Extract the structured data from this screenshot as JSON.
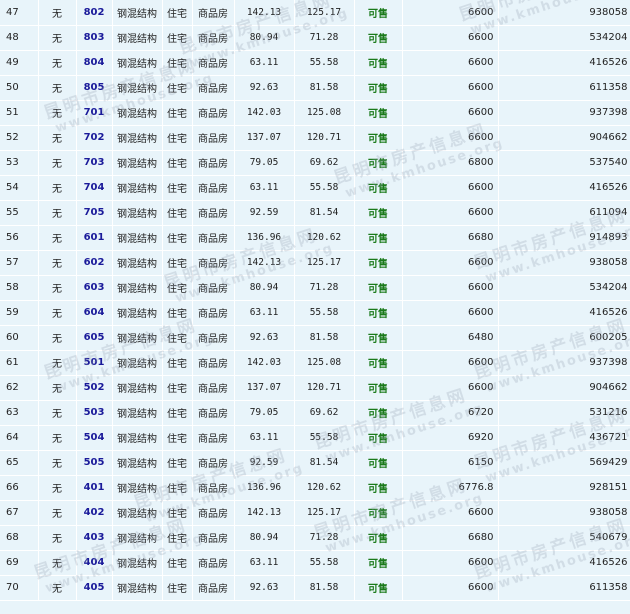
{
  "table": {
    "rows": [
      {
        "no": "47",
        "col2": "无",
        "room": "802",
        "structure": "钢混结构",
        "use": "住宅",
        "type": "商品房",
        "area1": "142.13",
        "area2": "125.17",
        "status": "可售",
        "price": "6600",
        "total": "938058"
      },
      {
        "no": "48",
        "col2": "无",
        "room": "803",
        "structure": "钢混结构",
        "use": "住宅",
        "type": "商品房",
        "area1": "80.94",
        "area2": "71.28",
        "status": "可售",
        "price": "6600",
        "total": "534204"
      },
      {
        "no": "49",
        "col2": "无",
        "room": "804",
        "structure": "钢混结构",
        "use": "住宅",
        "type": "商品房",
        "area1": "63.11",
        "area2": "55.58",
        "status": "可售",
        "price": "6600",
        "total": "416526"
      },
      {
        "no": "50",
        "col2": "无",
        "room": "805",
        "structure": "钢混结构",
        "use": "住宅",
        "type": "商品房",
        "area1": "92.63",
        "area2": "81.58",
        "status": "可售",
        "price": "6600",
        "total": "611358"
      },
      {
        "no": "51",
        "col2": "无",
        "room": "701",
        "structure": "钢混结构",
        "use": "住宅",
        "type": "商品房",
        "area1": "142.03",
        "area2": "125.08",
        "status": "可售",
        "price": "6600",
        "total": "937398"
      },
      {
        "no": "52",
        "col2": "无",
        "room": "702",
        "structure": "钢混结构",
        "use": "住宅",
        "type": "商品房",
        "area1": "137.07",
        "area2": "120.71",
        "status": "可售",
        "price": "6600",
        "total": "904662"
      },
      {
        "no": "53",
        "col2": "无",
        "room": "703",
        "structure": "钢混结构",
        "use": "住宅",
        "type": "商品房",
        "area1": "79.05",
        "area2": "69.62",
        "status": "可售",
        "price": "6800",
        "total": "537540"
      },
      {
        "no": "54",
        "col2": "无",
        "room": "704",
        "structure": "钢混结构",
        "use": "住宅",
        "type": "商品房",
        "area1": "63.11",
        "area2": "55.58",
        "status": "可售",
        "price": "6600",
        "total": "416526"
      },
      {
        "no": "55",
        "col2": "无",
        "room": "705",
        "structure": "钢混结构",
        "use": "住宅",
        "type": "商品房",
        "area1": "92.59",
        "area2": "81.54",
        "status": "可售",
        "price": "6600",
        "total": "611094"
      },
      {
        "no": "56",
        "col2": "无",
        "room": "601",
        "structure": "钢混结构",
        "use": "住宅",
        "type": "商品房",
        "area1": "136.96",
        "area2": "120.62",
        "status": "可售",
        "price": "6680",
        "total": "914893"
      },
      {
        "no": "57",
        "col2": "无",
        "room": "602",
        "structure": "钢混结构",
        "use": "住宅",
        "type": "商品房",
        "area1": "142.13",
        "area2": "125.17",
        "status": "可售",
        "price": "6600",
        "total": "938058"
      },
      {
        "no": "58",
        "col2": "无",
        "room": "603",
        "structure": "钢混结构",
        "use": "住宅",
        "type": "商品房",
        "area1": "80.94",
        "area2": "71.28",
        "status": "可售",
        "price": "6600",
        "total": "534204"
      },
      {
        "no": "59",
        "col2": "无",
        "room": "604",
        "structure": "钢混结构",
        "use": "住宅",
        "type": "商品房",
        "area1": "63.11",
        "area2": "55.58",
        "status": "可售",
        "price": "6600",
        "total": "416526"
      },
      {
        "no": "60",
        "col2": "无",
        "room": "605",
        "structure": "钢混结构",
        "use": "住宅",
        "type": "商品房",
        "area1": "92.63",
        "area2": "81.58",
        "status": "可售",
        "price": "6480",
        "total": "600205"
      },
      {
        "no": "61",
        "col2": "无",
        "room": "501",
        "structure": "钢混结构",
        "use": "住宅",
        "type": "商品房",
        "area1": "142.03",
        "area2": "125.08",
        "status": "可售",
        "price": "6600",
        "total": "937398"
      },
      {
        "no": "62",
        "col2": "无",
        "room": "502",
        "structure": "钢混结构",
        "use": "住宅",
        "type": "商品房",
        "area1": "137.07",
        "area2": "120.71",
        "status": "可售",
        "price": "6600",
        "total": "904662"
      },
      {
        "no": "63",
        "col2": "无",
        "room": "503",
        "structure": "钢混结构",
        "use": "住宅",
        "type": "商品房",
        "area1": "79.05",
        "area2": "69.62",
        "status": "可售",
        "price": "6720",
        "total": "531216"
      },
      {
        "no": "64",
        "col2": "无",
        "room": "504",
        "structure": "钢混结构",
        "use": "住宅",
        "type": "商品房",
        "area1": "63.11",
        "area2": "55.58",
        "status": "可售",
        "price": "6920",
        "total": "436721"
      },
      {
        "no": "65",
        "col2": "无",
        "room": "505",
        "structure": "钢混结构",
        "use": "住宅",
        "type": "商品房",
        "area1": "92.59",
        "area2": "81.54",
        "status": "可售",
        "price": "6150",
        "total": "569429"
      },
      {
        "no": "66",
        "col2": "无",
        "room": "401",
        "structure": "钢混结构",
        "use": "住宅",
        "type": "商品房",
        "area1": "136.96",
        "area2": "120.62",
        "status": "可售",
        "price": "6776.8",
        "total": "928151"
      },
      {
        "no": "67",
        "col2": "无",
        "room": "402",
        "structure": "钢混结构",
        "use": "住宅",
        "type": "商品房",
        "area1": "142.13",
        "area2": "125.17",
        "status": "可售",
        "price": "6600",
        "total": "938058"
      },
      {
        "no": "68",
        "col2": "无",
        "room": "403",
        "structure": "钢混结构",
        "use": "住宅",
        "type": "商品房",
        "area1": "80.94",
        "area2": "71.28",
        "status": "可售",
        "price": "6680",
        "total": "540679"
      },
      {
        "no": "69",
        "col2": "无",
        "room": "404",
        "structure": "钢混结构",
        "use": "住宅",
        "type": "商品房",
        "area1": "63.11",
        "area2": "55.58",
        "status": "可售",
        "price": "6600",
        "total": "416526"
      },
      {
        "no": "70",
        "col2": "无",
        "room": "405",
        "structure": "钢混结构",
        "use": "住宅",
        "type": "商品房",
        "area1": "92.63",
        "area2": "81.58",
        "status": "可售",
        "price": "6600",
        "total": "611358"
      }
    ]
  },
  "watermark": {
    "cn": "昆明市房产信息网",
    "en": "www.kmhouse.org"
  },
  "colors": {
    "row_bg": "#e8f4fa",
    "room_text": "#1a1a9a",
    "status_text": "#1a7a1a",
    "watermark": "#96a0b4"
  }
}
